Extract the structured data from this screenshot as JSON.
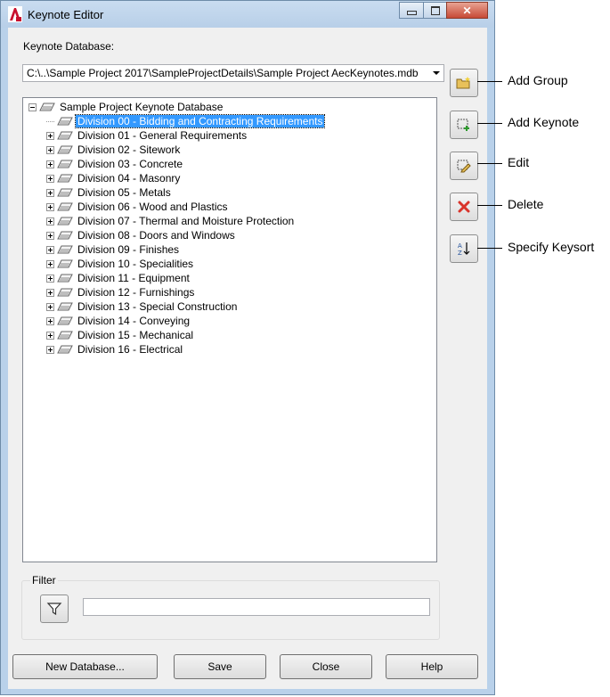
{
  "window": {
    "title": "Keynote Editor",
    "minimize_glyph": "▭",
    "maximize_glyph": "▢",
    "close_glyph": "✕"
  },
  "database": {
    "label": "Keynote Database:",
    "value": "C:\\..\\Sample Project 2017\\SampleProjectDetails\\Sample Project AecKeynotes.mdb"
  },
  "tree": {
    "root": "Sample Project Keynote Database",
    "items": [
      {
        "label": "Division 00 - Bidding and Contracting Requirements",
        "selected": true
      },
      {
        "label": "Division 01 - General Requirements"
      },
      {
        "label": "Division 02 - Sitework"
      },
      {
        "label": "Division 03 - Concrete"
      },
      {
        "label": "Division 04 - Masonry"
      },
      {
        "label": "Division 05 - Metals"
      },
      {
        "label": "Division 06 - Wood and Plastics"
      },
      {
        "label": "Division 07 - Thermal and Moisture Protection"
      },
      {
        "label": "Division 08 - Doors and Windows"
      },
      {
        "label": "Division 09 - Finishes"
      },
      {
        "label": "Division 10 - Specialities"
      },
      {
        "label": "Division 11 - Equipment"
      },
      {
        "label": "Division 12 - Furnishings"
      },
      {
        "label": "Division 13 - Special Construction"
      },
      {
        "label": "Division 14 - Conveying"
      },
      {
        "label": "Division 15 - Mechanical"
      },
      {
        "label": "Division 16 - Electrical"
      }
    ]
  },
  "callouts": {
    "add_group": "Add Group",
    "add_keynote": "Add Keynote",
    "edit": "Edit",
    "delete": "Delete",
    "keysort": "Specify Keysort"
  },
  "filter": {
    "label": "Filter",
    "value": ""
  },
  "buttons": {
    "new_database": "New Database...",
    "save": "Save",
    "close": "Close",
    "help": "Help"
  },
  "colors": {
    "selection": "#3399ff",
    "delete_icon": "#d9342b",
    "add_icon": "#2e9a2e",
    "folder_icon": "#e8c15a"
  }
}
